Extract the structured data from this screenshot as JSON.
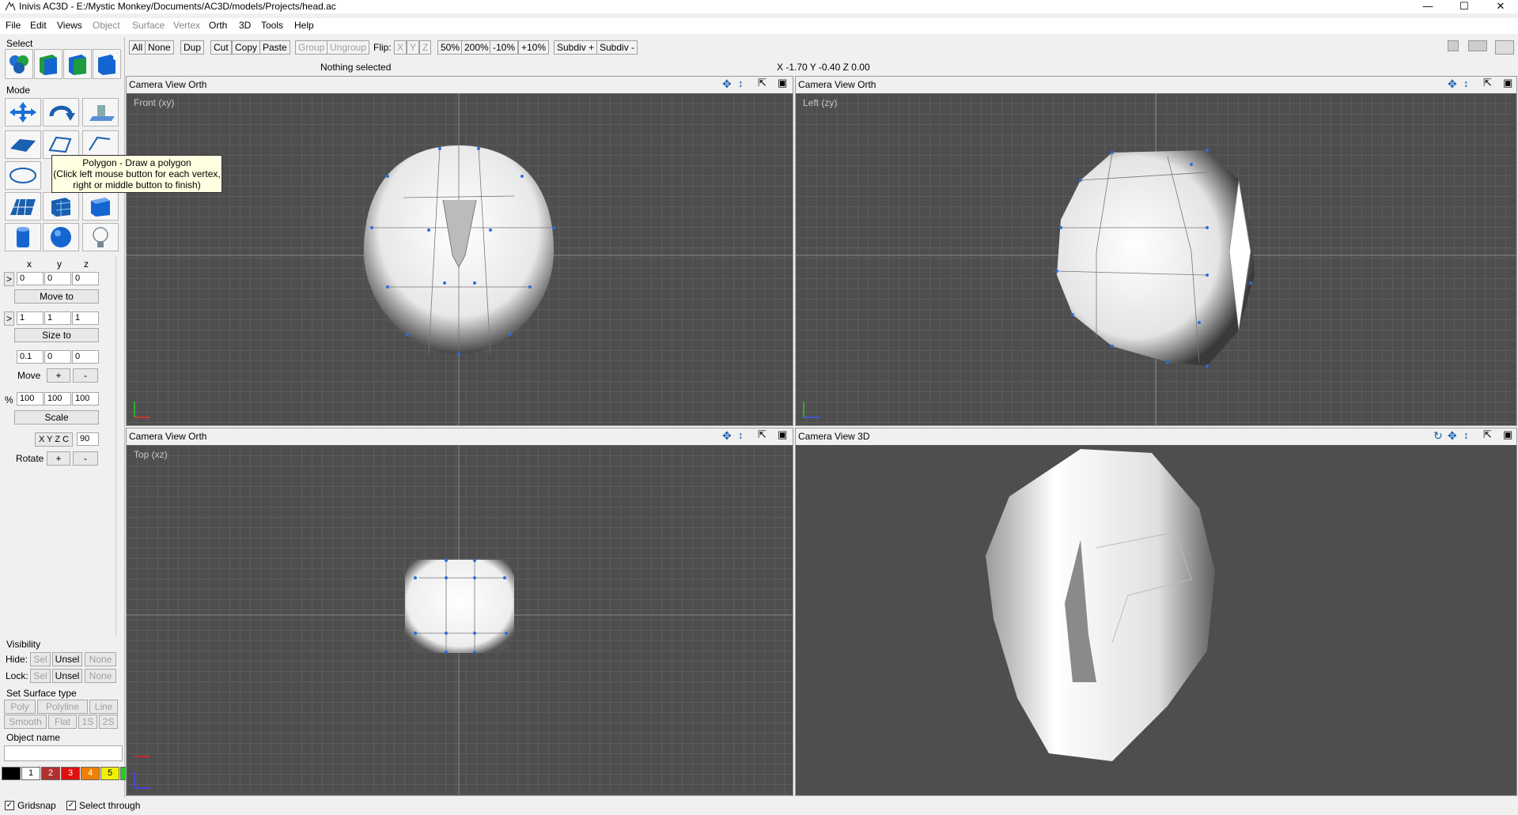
{
  "window": {
    "title": "Inivis AC3D - E:/Mystic Monkey/Documents/AC3D/models/Projects/head.ac",
    "minimize": "—",
    "maximize": "☐",
    "close": "✕"
  },
  "menu": [
    "File",
    "Edit",
    "Views",
    "Object",
    "Surface",
    "Vertex",
    "Orth",
    "3D",
    "Tools",
    "Help"
  ],
  "toolbar": {
    "all": "All",
    "none": "None",
    "dup": "Dup",
    "cut": "Cut",
    "copy": "Copy",
    "paste": "Paste",
    "group": "Group",
    "ungroup": "Ungroup",
    "flip": "Flip:",
    "x": "X",
    "y": "Y",
    "z": "Z",
    "z50": "50%",
    "z200": "200%",
    "m10": "-10%",
    "p10": "+10%",
    "subdivp": "Subdiv +",
    "subdivm": "Subdiv -"
  },
  "status": {
    "selection": "Nothing selected",
    "coords": "X -1.70 Y -0.40 Z 0.00"
  },
  "left": {
    "select_label": "Select",
    "mode_label": "Mode",
    "xyz": [
      "x",
      "y",
      "z"
    ],
    "pos": [
      "0",
      "0",
      "0"
    ],
    "move_to": "Move to",
    "size": [
      "1",
      "1",
      "1"
    ],
    "size_to": "Size to",
    "step": [
      "0.1",
      "0",
      "0"
    ],
    "move": "Move",
    "plus": "+",
    "minus": "-",
    "pct": "%",
    "scale_vals": [
      "100",
      "100",
      "100"
    ],
    "scale": "Scale",
    "axes": "X Y Z C",
    "angle": "90",
    "rotate": "Rotate",
    "arrow": ">",
    "visibility": "Visibility",
    "hide": "Hide:",
    "lock": "Lock:",
    "sel": "Sel",
    "unsel": "Unsel",
    "vnone": "None",
    "surface_type": "Set Surface type",
    "poly": "Poly",
    "polyline": "Polyline",
    "line": "Line",
    "smooth": "Smooth",
    "flat": "Flat",
    "s1": "1S",
    "s2": "2S",
    "object_name": "Object name",
    "object_name_value": "",
    "colors": [
      {
        "n": "",
        "c": "#000000"
      },
      {
        "n": "1",
        "c": "#ffffff"
      },
      {
        "n": "2",
        "c": "#b03030"
      },
      {
        "n": "3",
        "c": "#e01010"
      },
      {
        "n": "4",
        "c": "#f08000"
      },
      {
        "n": "5",
        "c": "#f0f000"
      },
      {
        "n": "",
        "c": "#20d020"
      }
    ]
  },
  "tooltip": {
    "line1": "Polygon - Draw a polygon",
    "line2": "(Click left mouse button for each vertex,",
    "line3": "right or middle button to finish)"
  },
  "viewports": [
    {
      "menu": "Camera  View  Orth",
      "label": "Front (xy)"
    },
    {
      "menu": "Camera  View  Orth",
      "label": "Left (zy)"
    },
    {
      "menu": "Camera  View  Orth",
      "label": "Top (xz)"
    },
    {
      "menu": "Camera  View  3D",
      "label": ""
    }
  ],
  "bottom": {
    "gridsnap": "Gridsnap",
    "select_through": "Select through",
    "check": "✓"
  }
}
